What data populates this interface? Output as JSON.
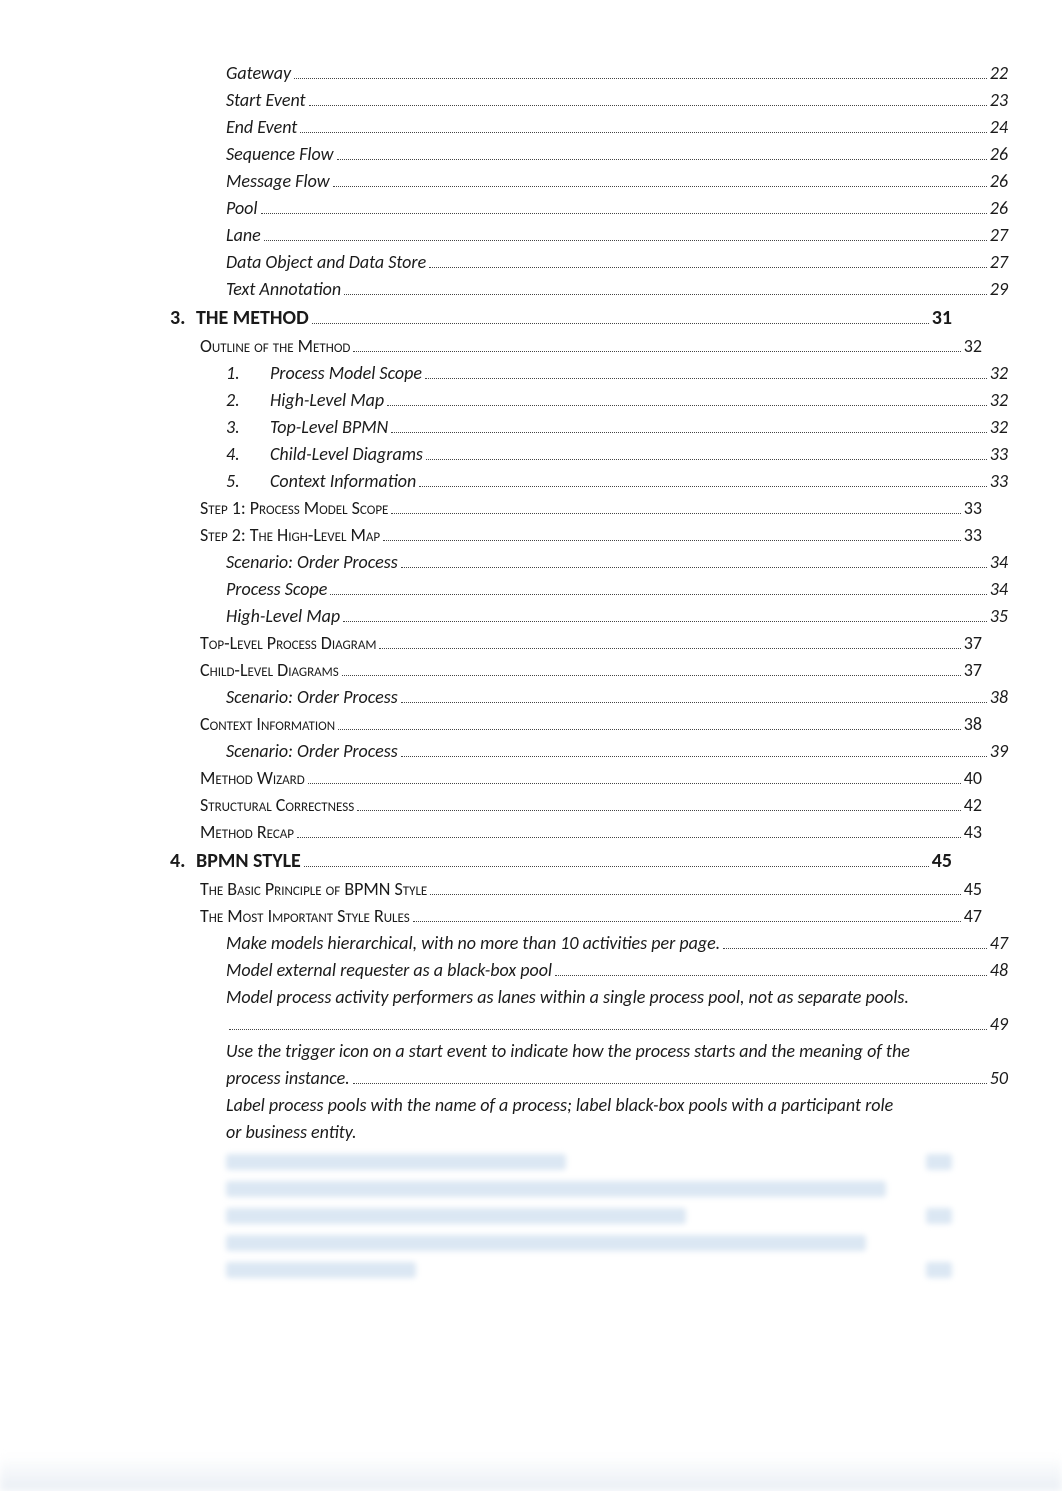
{
  "toc": [
    {
      "level": "it",
      "indent": 2,
      "label": "Gateway",
      "page": "22"
    },
    {
      "level": "it",
      "indent": 2,
      "label": "Start Event",
      "page": "23"
    },
    {
      "level": "it",
      "indent": 2,
      "label": "End Event",
      "page": "24"
    },
    {
      "level": "it",
      "indent": 2,
      "label": "Sequence Flow",
      "page": "26"
    },
    {
      "level": "it",
      "indent": 2,
      "label": "Message Flow",
      "page": "26"
    },
    {
      "level": "it",
      "indent": 2,
      "label": "Pool",
      "page": "26"
    },
    {
      "level": "it",
      "indent": 2,
      "label": "Lane",
      "page": "27"
    },
    {
      "level": "it",
      "indent": 2,
      "label": "Data Object and Data Store",
      "page": "27"
    },
    {
      "level": "it",
      "indent": 2,
      "label": "Text Annotation",
      "page": "29"
    },
    {
      "level": "h",
      "indent": 0,
      "num": "3.",
      "label": "THE METHOD",
      "page": "31"
    },
    {
      "level": "sc",
      "indent": 1,
      "label": "Outline of the Method",
      "page": "32"
    },
    {
      "level": "it-num",
      "indent": 3,
      "num": "1.",
      "label": "Process Model Scope",
      "page": "32"
    },
    {
      "level": "it-num",
      "indent": 3,
      "num": "2.",
      "label": "High-Level Map",
      "page": "32"
    },
    {
      "level": "it-num",
      "indent": 3,
      "num": "3.",
      "label": "Top-Level BPMN",
      "page": "32"
    },
    {
      "level": "it-num",
      "indent": 3,
      "num": "4.",
      "label": "Child-Level Diagrams",
      "page": "33"
    },
    {
      "level": "it-num",
      "indent": 3,
      "num": "5.",
      "label": "Context Information",
      "page": "33"
    },
    {
      "level": "sc",
      "indent": 1,
      "label": "Step 1: Process Model Scope",
      "page": "33"
    },
    {
      "level": "sc",
      "indent": 1,
      "label": "Step 2: The High-Level Map",
      "page": "33"
    },
    {
      "level": "it",
      "indent": 2,
      "label": "Scenario: Order Process",
      "page": "34"
    },
    {
      "level": "it",
      "indent": 2,
      "label": "Process Scope",
      "page": "34"
    },
    {
      "level": "it",
      "indent": 2,
      "label": "High-Level Map",
      "page": "35"
    },
    {
      "level": "sc",
      "indent": 1,
      "label": "Top-Level Process Diagram",
      "page": "37"
    },
    {
      "level": "sc",
      "indent": 1,
      "label": "Child-Level Diagrams",
      "page": "37"
    },
    {
      "level": "it",
      "indent": 2,
      "label": "Scenario: Order Process",
      "page": "38"
    },
    {
      "level": "sc",
      "indent": 1,
      "label": "Context Information",
      "page": "38"
    },
    {
      "level": "it",
      "indent": 2,
      "label": "Scenario: Order Process",
      "page": "39"
    },
    {
      "level": "sc",
      "indent": 1,
      "label": "Method Wizard",
      "page": "40"
    },
    {
      "level": "sc",
      "indent": 1,
      "label": "Structural Correctness",
      "page": "42"
    },
    {
      "level": "sc",
      "indent": 1,
      "label": "Method Recap",
      "page": "43"
    },
    {
      "level": "h",
      "indent": 0,
      "num": "4.",
      "label": "BPMN STYLE",
      "page": "45"
    },
    {
      "level": "sc",
      "indent": 1,
      "label": "The Basic Principle of BPMN Style",
      "page": "45"
    },
    {
      "level": "sc",
      "indent": 1,
      "label": "The Most Important Style Rules",
      "page": "47"
    },
    {
      "level": "it",
      "indent": 2,
      "label": "Make models hierarchical, with no more than 10 activities per page.",
      "page": "47"
    },
    {
      "level": "it",
      "indent": 2,
      "label": "Model external requester as a black-box pool",
      "page": "48"
    },
    {
      "level": "it",
      "indent": 2,
      "label": "Model process activity performers as lanes within a single process pool, not as separate pools.",
      "page": "49",
      "wrap": true
    },
    {
      "level": "it",
      "indent": 2,
      "label": "Use the trigger icon on a start event to indicate how the process starts and the meaning of the process instance.",
      "page": "50",
      "wrap": true
    },
    {
      "level": "it",
      "indent": 2,
      "label": "Label process pools with the name of a process; label black-box pools with a participant role or business entity.",
      "page": "",
      "wrap": true,
      "nopage": true
    }
  ],
  "stubs": [
    {
      "width1": 340,
      "pg": true
    },
    {
      "width1": 660,
      "pg": false
    },
    {
      "width1": 460,
      "pg": true
    },
    {
      "width1": 640,
      "pg": false
    },
    {
      "width1": 190,
      "pg": true
    }
  ]
}
